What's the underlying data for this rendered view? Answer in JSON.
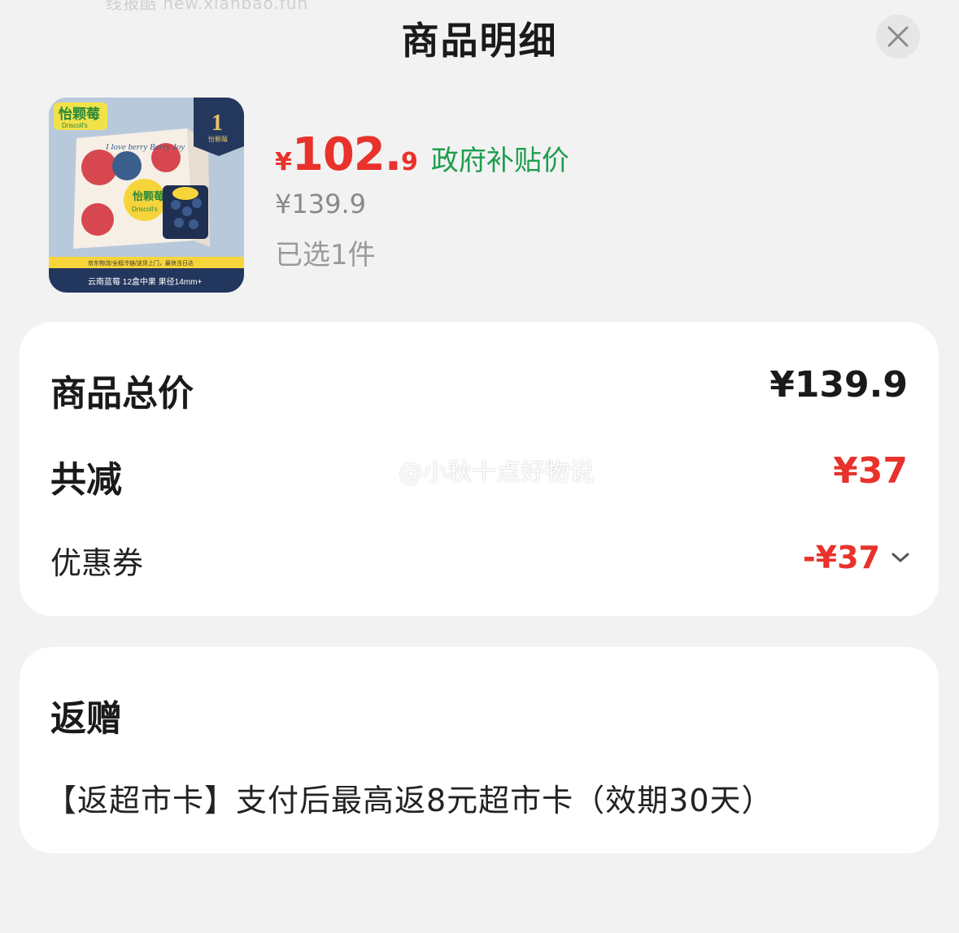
{
  "watermark_top": "线报酷 new.xianbao.fun",
  "header": {
    "title": "商品明细",
    "close_icon": "close-icon"
  },
  "product": {
    "image": {
      "brand_cn": "怡颗莓",
      "brand_en": "Driscoll's",
      "badge_number": "1",
      "badge_text": "怡颗莓",
      "box_text": "I love berry Berry Joy",
      "footer_line1": "京东物流/全程冷链/送货上门，最快当日达",
      "footer_line2": "云南蓝莓 12盒中果 果径14mm+"
    },
    "currency": "¥",
    "price_integer": "102.",
    "price_decimal": "9",
    "subsidy_label": "政府补贴价",
    "original_price": "¥139.9",
    "selected": "已选1件"
  },
  "summary": {
    "total_label": "商品总价",
    "total_value": "¥139.9",
    "reduce_label": "共减",
    "reduce_value": "¥37",
    "coupon_label": "优惠券",
    "coupon_value": "-¥37"
  },
  "watermark": {
    "text": "@小秋十点好物说"
  },
  "gift": {
    "title": "返赠",
    "text": "【返超市卡】支付后最高返8元超市卡（效期30天）"
  },
  "colors": {
    "accent_red": "#e8322b",
    "subsidy_green": "#1e9e4f",
    "background": "#f2f2f2",
    "card": "#ffffff"
  }
}
